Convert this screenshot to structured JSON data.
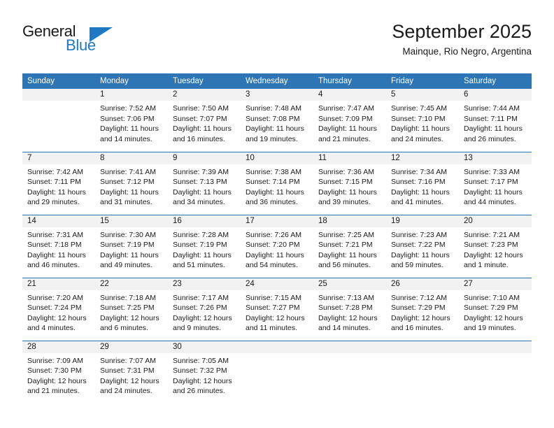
{
  "logo": {
    "text_top": "General",
    "text_bottom": "Blue",
    "triangle_color": "#1f78c1",
    "blue_color": "#1f78c1",
    "dark_color": "#1a1a1a"
  },
  "header": {
    "title": "September 2025",
    "subtitle": "Mainque, Rio Negro, Argentina"
  },
  "calendar": {
    "header_bg": "#2e75b6",
    "daynum_bg": "#f2f2f2",
    "weekday_headers": [
      "Sunday",
      "Monday",
      "Tuesday",
      "Wednesday",
      "Thursday",
      "Friday",
      "Saturday"
    ],
    "weeks": [
      [
        {
          "day": "",
          "lines": []
        },
        {
          "day": "1",
          "lines": [
            "Sunrise: 7:52 AM",
            "Sunset: 7:06 PM",
            "Daylight: 11 hours",
            "and 14 minutes."
          ]
        },
        {
          "day": "2",
          "lines": [
            "Sunrise: 7:50 AM",
            "Sunset: 7:07 PM",
            "Daylight: 11 hours",
            "and 16 minutes."
          ]
        },
        {
          "day": "3",
          "lines": [
            "Sunrise: 7:48 AM",
            "Sunset: 7:08 PM",
            "Daylight: 11 hours",
            "and 19 minutes."
          ]
        },
        {
          "day": "4",
          "lines": [
            "Sunrise: 7:47 AM",
            "Sunset: 7:09 PM",
            "Daylight: 11 hours",
            "and 21 minutes."
          ]
        },
        {
          "day": "5",
          "lines": [
            "Sunrise: 7:45 AM",
            "Sunset: 7:10 PM",
            "Daylight: 11 hours",
            "and 24 minutes."
          ]
        },
        {
          "day": "6",
          "lines": [
            "Sunrise: 7:44 AM",
            "Sunset: 7:11 PM",
            "Daylight: 11 hours",
            "and 26 minutes."
          ]
        }
      ],
      [
        {
          "day": "7",
          "lines": [
            "Sunrise: 7:42 AM",
            "Sunset: 7:11 PM",
            "Daylight: 11 hours",
            "and 29 minutes."
          ]
        },
        {
          "day": "8",
          "lines": [
            "Sunrise: 7:41 AM",
            "Sunset: 7:12 PM",
            "Daylight: 11 hours",
            "and 31 minutes."
          ]
        },
        {
          "day": "9",
          "lines": [
            "Sunrise: 7:39 AM",
            "Sunset: 7:13 PM",
            "Daylight: 11 hours",
            "and 34 minutes."
          ]
        },
        {
          "day": "10",
          "lines": [
            "Sunrise: 7:38 AM",
            "Sunset: 7:14 PM",
            "Daylight: 11 hours",
            "and 36 minutes."
          ]
        },
        {
          "day": "11",
          "lines": [
            "Sunrise: 7:36 AM",
            "Sunset: 7:15 PM",
            "Daylight: 11 hours",
            "and 39 minutes."
          ]
        },
        {
          "day": "12",
          "lines": [
            "Sunrise: 7:34 AM",
            "Sunset: 7:16 PM",
            "Daylight: 11 hours",
            "and 41 minutes."
          ]
        },
        {
          "day": "13",
          "lines": [
            "Sunrise: 7:33 AM",
            "Sunset: 7:17 PM",
            "Daylight: 11 hours",
            "and 44 minutes."
          ]
        }
      ],
      [
        {
          "day": "14",
          "lines": [
            "Sunrise: 7:31 AM",
            "Sunset: 7:18 PM",
            "Daylight: 11 hours",
            "and 46 minutes."
          ]
        },
        {
          "day": "15",
          "lines": [
            "Sunrise: 7:30 AM",
            "Sunset: 7:19 PM",
            "Daylight: 11 hours",
            "and 49 minutes."
          ]
        },
        {
          "day": "16",
          "lines": [
            "Sunrise: 7:28 AM",
            "Sunset: 7:19 PM",
            "Daylight: 11 hours",
            "and 51 minutes."
          ]
        },
        {
          "day": "17",
          "lines": [
            "Sunrise: 7:26 AM",
            "Sunset: 7:20 PM",
            "Daylight: 11 hours",
            "and 54 minutes."
          ]
        },
        {
          "day": "18",
          "lines": [
            "Sunrise: 7:25 AM",
            "Sunset: 7:21 PM",
            "Daylight: 11 hours",
            "and 56 minutes."
          ]
        },
        {
          "day": "19",
          "lines": [
            "Sunrise: 7:23 AM",
            "Sunset: 7:22 PM",
            "Daylight: 11 hours",
            "and 59 minutes."
          ]
        },
        {
          "day": "20",
          "lines": [
            "Sunrise: 7:21 AM",
            "Sunset: 7:23 PM",
            "Daylight: 12 hours",
            "and 1 minute."
          ]
        }
      ],
      [
        {
          "day": "21",
          "lines": [
            "Sunrise: 7:20 AM",
            "Sunset: 7:24 PM",
            "Daylight: 12 hours",
            "and 4 minutes."
          ]
        },
        {
          "day": "22",
          "lines": [
            "Sunrise: 7:18 AM",
            "Sunset: 7:25 PM",
            "Daylight: 12 hours",
            "and 6 minutes."
          ]
        },
        {
          "day": "23",
          "lines": [
            "Sunrise: 7:17 AM",
            "Sunset: 7:26 PM",
            "Daylight: 12 hours",
            "and 9 minutes."
          ]
        },
        {
          "day": "24",
          "lines": [
            "Sunrise: 7:15 AM",
            "Sunset: 7:27 PM",
            "Daylight: 12 hours",
            "and 11 minutes."
          ]
        },
        {
          "day": "25",
          "lines": [
            "Sunrise: 7:13 AM",
            "Sunset: 7:28 PM",
            "Daylight: 12 hours",
            "and 14 minutes."
          ]
        },
        {
          "day": "26",
          "lines": [
            "Sunrise: 7:12 AM",
            "Sunset: 7:29 PM",
            "Daylight: 12 hours",
            "and 16 minutes."
          ]
        },
        {
          "day": "27",
          "lines": [
            "Sunrise: 7:10 AM",
            "Sunset: 7:29 PM",
            "Daylight: 12 hours",
            "and 19 minutes."
          ]
        }
      ],
      [
        {
          "day": "28",
          "lines": [
            "Sunrise: 7:09 AM",
            "Sunset: 7:30 PM",
            "Daylight: 12 hours",
            "and 21 minutes."
          ]
        },
        {
          "day": "29",
          "lines": [
            "Sunrise: 7:07 AM",
            "Sunset: 7:31 PM",
            "Daylight: 12 hours",
            "and 24 minutes."
          ]
        },
        {
          "day": "30",
          "lines": [
            "Sunrise: 7:05 AM",
            "Sunset: 7:32 PM",
            "Daylight: 12 hours",
            "and 26 minutes."
          ]
        },
        {
          "day": "",
          "lines": []
        },
        {
          "day": "",
          "lines": []
        },
        {
          "day": "",
          "lines": []
        },
        {
          "day": "",
          "lines": []
        }
      ]
    ]
  }
}
